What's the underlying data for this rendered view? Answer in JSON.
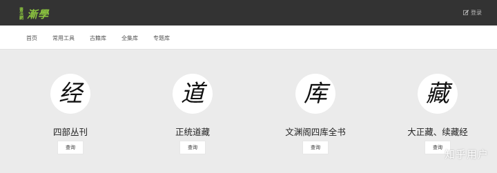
{
  "header": {
    "logo_small": "書法網",
    "logo_big": "漸學",
    "login_label": "登录",
    "login_icon": "edit-icon"
  },
  "nav": {
    "items": [
      "首页",
      "常用工具",
      "古籍库",
      "全集库",
      "专题库"
    ]
  },
  "cards": [
    {
      "glyph": "经",
      "title": "四部丛刊",
      "button": "查询"
    },
    {
      "glyph": "道",
      "title": "正统道藏",
      "button": "查询"
    },
    {
      "glyph": "库",
      "title": "文渊阁四库全书",
      "button": "查询"
    },
    {
      "glyph": "藏",
      "title": "大正藏、续藏经",
      "button": "查询"
    }
  ],
  "watermark": "知乎用户",
  "colors": {
    "topbar": "#333333",
    "logo": "#8cc63f",
    "background": "#ebebeb"
  }
}
